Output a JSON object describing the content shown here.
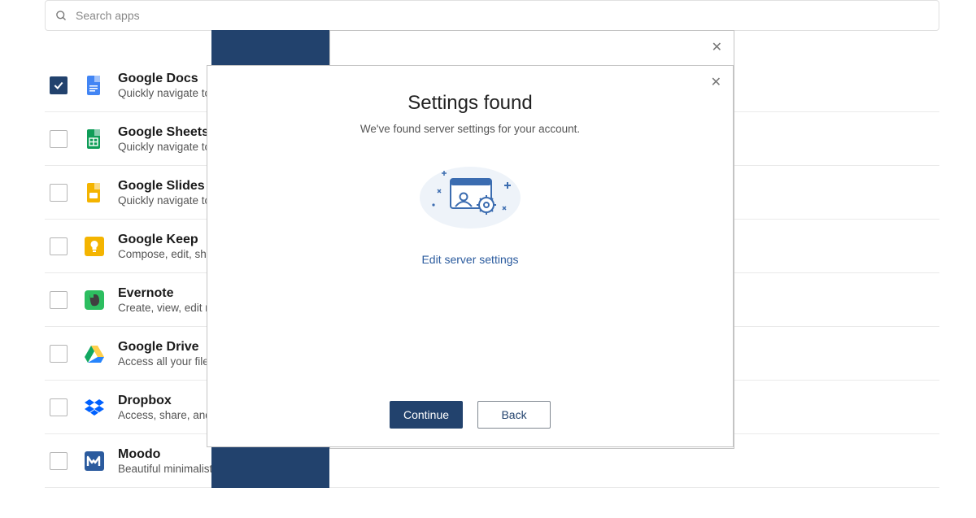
{
  "search": {
    "placeholder": "Search apps"
  },
  "apps": [
    {
      "title": "Google Docs",
      "desc": "Quickly navigate to your recent Google Docs",
      "checked": true,
      "icon": "gdocs"
    },
    {
      "title": "Google Sheets",
      "desc": "Quickly navigate to your recent Google Sheets",
      "checked": false,
      "icon": "gsheets"
    },
    {
      "title": "Google Slides",
      "desc": "Quickly navigate to your recent Google Slides",
      "checked": false,
      "icon": "gslides"
    },
    {
      "title": "Google Keep",
      "desc": "Compose, edit, share and view your notes",
      "checked": false,
      "icon": "gkeep"
    },
    {
      "title": "Evernote",
      "desc": "Create, view, edit notes",
      "checked": false,
      "icon": "evernote"
    },
    {
      "title": "Google Drive",
      "desc": "Access all your files in Google Drive",
      "checked": false,
      "icon": "gdrive"
    },
    {
      "title": "Dropbox",
      "desc": "Access, share, and organize files",
      "checked": false,
      "icon": "dropbox"
    },
    {
      "title": "Moodo",
      "desc": "Beautiful minimalistic to-do list",
      "checked": false,
      "icon": "moodo"
    }
  ],
  "modal": {
    "title": "Settings found",
    "subtitle": "We've found server settings for your account.",
    "edit_link": "Edit server settings",
    "continue": "Continue",
    "back": "Back"
  }
}
